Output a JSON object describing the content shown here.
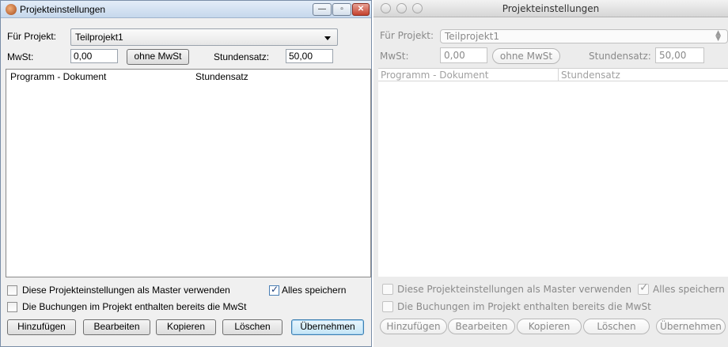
{
  "windows_dialog": {
    "title": "Projekteinstellungen",
    "project_label": "Für Projekt:",
    "project_value": "Teilprojekt1",
    "vat_label": "MwSt:",
    "vat_value": "0,00",
    "no_vat_button": "ohne MwSt",
    "rate_label": "Stundensatz:",
    "rate_value": "50,00",
    "table_columns": [
      "Programm - Dokument",
      "Stundensatz"
    ],
    "master_checkbox": {
      "label": "Diese Projekteinstellungen als Master verwenden",
      "checked": false
    },
    "save_all_checkbox": {
      "label": "Alles speichern",
      "checked": true
    },
    "vat_included_checkbox": {
      "label": "Die Buchungen im Projekt enthalten bereits die MwSt",
      "checked": false
    },
    "buttons": [
      "Hinzufügen",
      "Bearbeiten",
      "Kopieren",
      "Löschen",
      "Übernehmen"
    ]
  },
  "mac_dialog": {
    "title": "Projekteinstellungen",
    "project_label": "Für Projekt:",
    "project_value": "Teilprojekt1",
    "vat_label": "MwSt:",
    "vat_value": "0,00",
    "no_vat_button": "ohne MwSt",
    "rate_label": "Stundensatz:",
    "rate_value": "50,00",
    "table_columns": [
      "Programm - Dokument",
      "Stundensatz"
    ],
    "master_checkbox": {
      "label": "Diese Projekteinstellungen als Master verwenden",
      "checked": false
    },
    "save_all_checkbox": {
      "label": "Alles speichern",
      "checked": true
    },
    "vat_included_checkbox": {
      "label": "Die Buchungen im Projekt enthalten bereits die MwSt",
      "checked": false
    },
    "buttons": [
      "Hinzufügen",
      "Bearbeiten",
      "Kopieren",
      "Löschen",
      "Übernehmen"
    ]
  }
}
